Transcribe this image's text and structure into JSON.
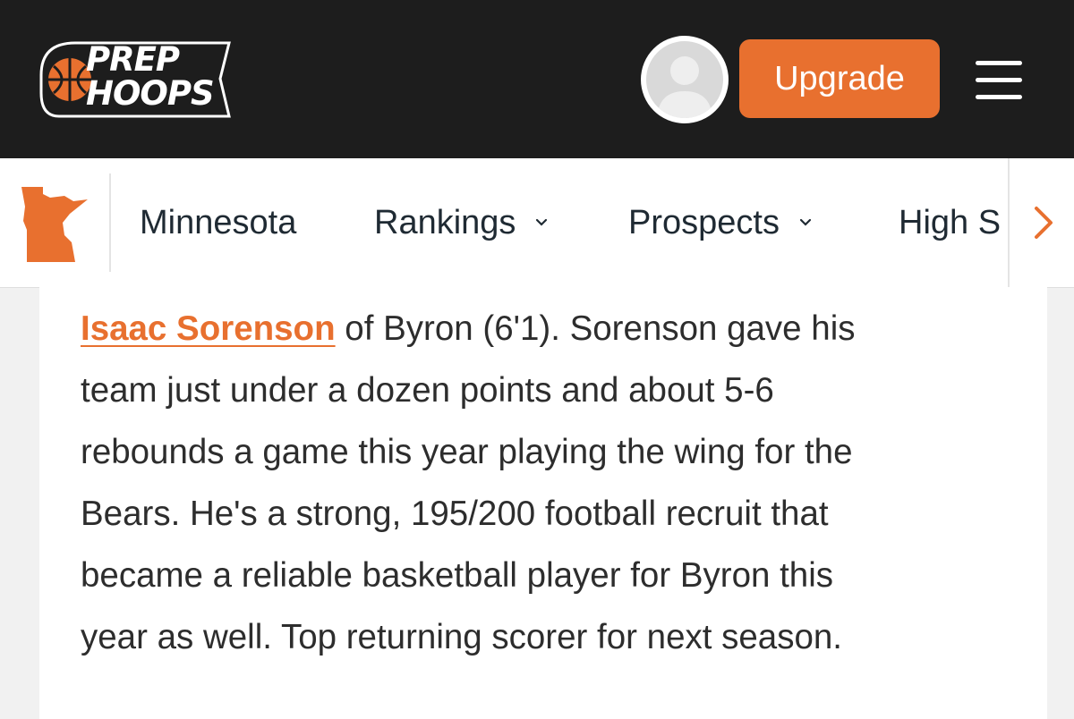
{
  "header": {
    "logo_line1": "PREP",
    "logo_line2": "HOOPS",
    "upgrade_label": "Upgrade",
    "colors": {
      "background": "#1d1d1d",
      "accent": "#e8702f"
    }
  },
  "nav": {
    "state_icon": "minnesota-map-icon",
    "items": [
      {
        "label": "Minnesota",
        "dropdown": false
      },
      {
        "label": "Rankings",
        "dropdown": true
      },
      {
        "label": "Prospects",
        "dropdown": true
      },
      {
        "label": "High S",
        "dropdown": false
      }
    ],
    "scroll_icon": "chevron-right-icon"
  },
  "article": {
    "player_link": "Isaac Sorenson",
    "lines": [
      " of Byron (6'1). Sorenson gave his",
      "team just under a dozen points and about 5-6",
      "rebounds a game this year playing the wing for the",
      "Bears.  He's a strong, 195/200 football recruit that",
      "became a reliable basketball player for Byron this",
      "year as well.  Top returning scorer for next season."
    ]
  }
}
